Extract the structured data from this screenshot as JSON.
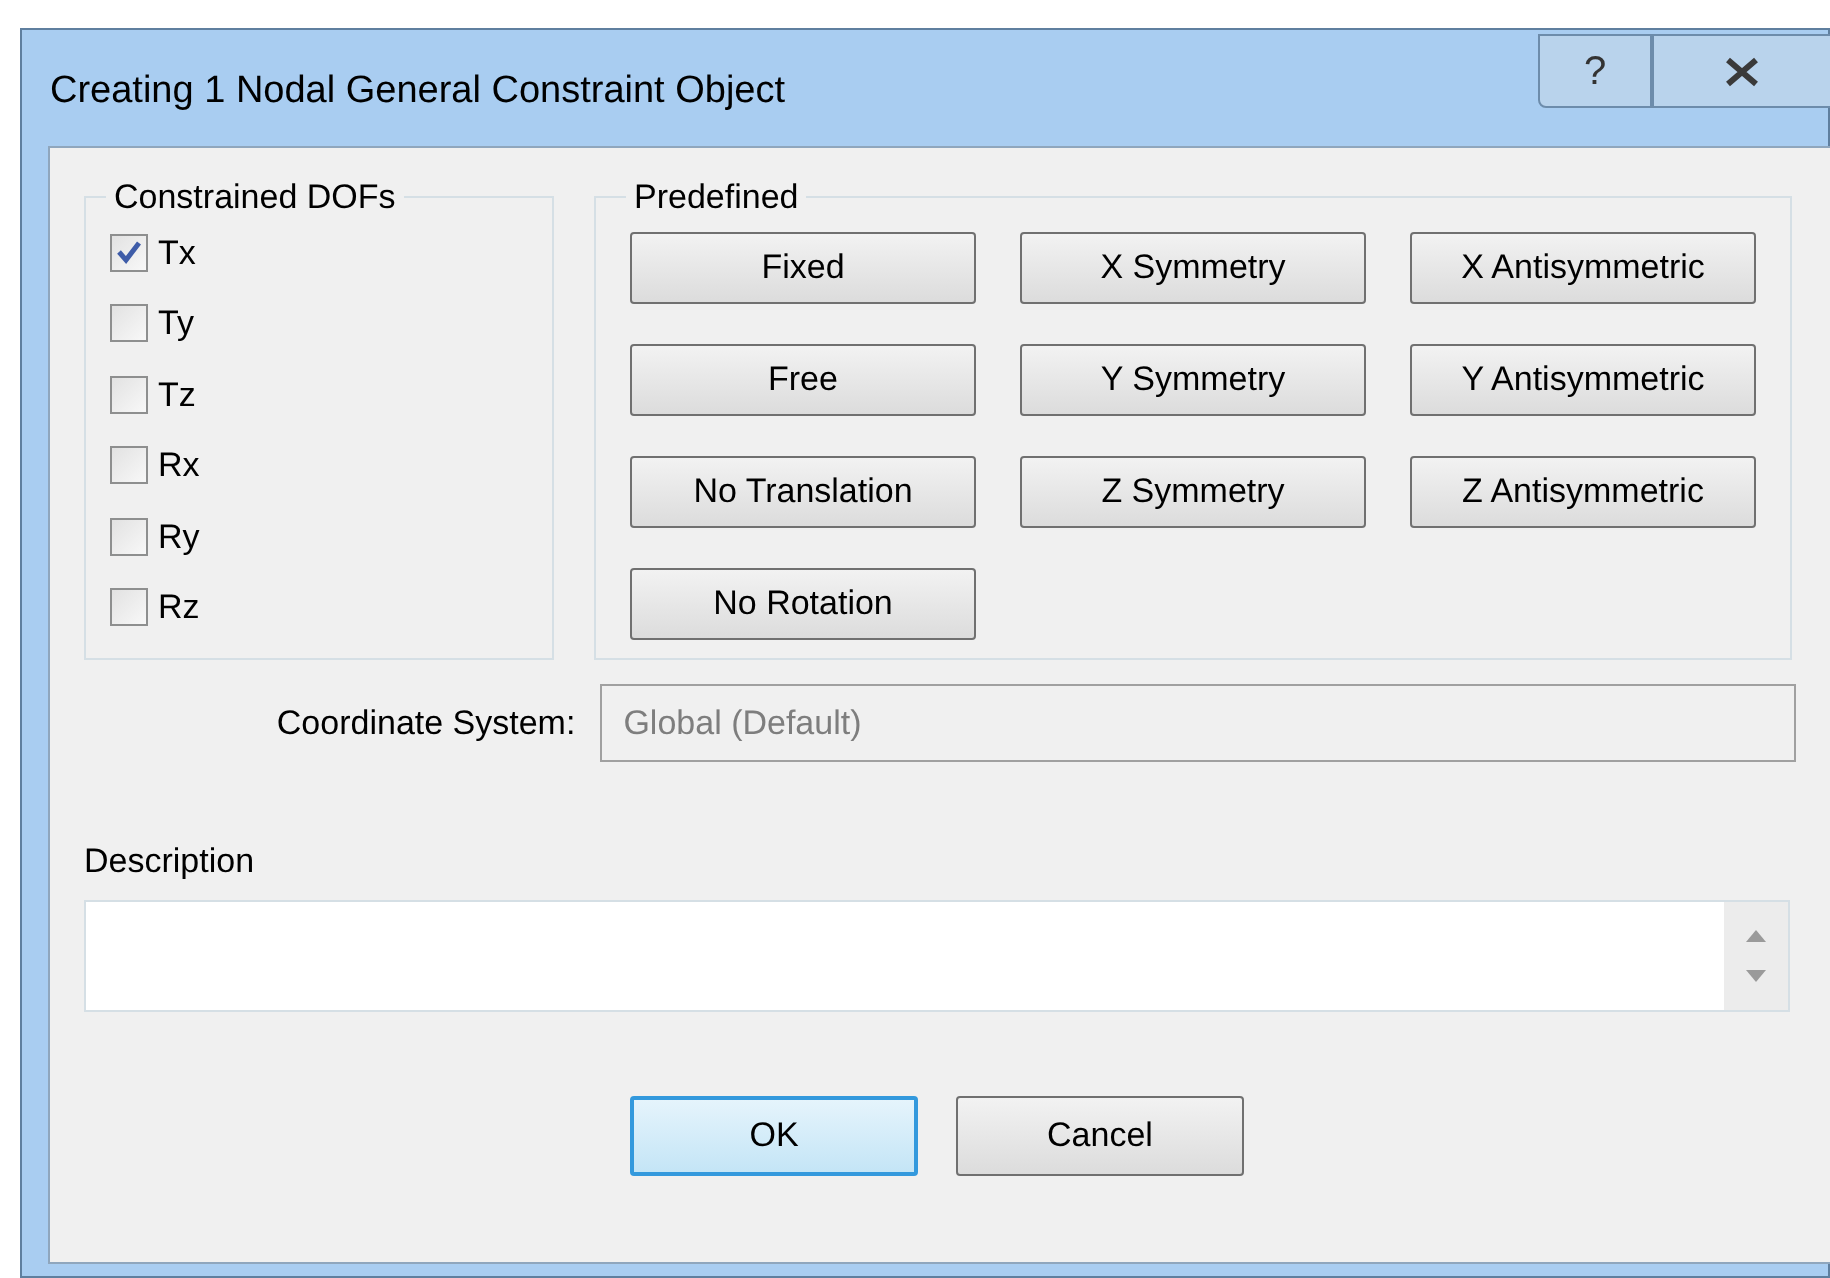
{
  "window": {
    "title": "Creating 1 Nodal General Constraint Object",
    "help_label": "?"
  },
  "constrained_dofs": {
    "title": "Constrained DOFs",
    "items": [
      {
        "label": "Tx",
        "checked": true
      },
      {
        "label": "Ty",
        "checked": false
      },
      {
        "label": "Tz",
        "checked": false
      },
      {
        "label": "Rx",
        "checked": false
      },
      {
        "label": "Ry",
        "checked": false
      },
      {
        "label": "Rz",
        "checked": false
      }
    ]
  },
  "predefined": {
    "title": "Predefined",
    "buttons": [
      {
        "label": "Fixed"
      },
      {
        "label": "X Symmetry"
      },
      {
        "label": "X Antisymmetric"
      },
      {
        "label": "Free"
      },
      {
        "label": "Y Symmetry"
      },
      {
        "label": "Y Antisymmetric"
      },
      {
        "label": "No Translation"
      },
      {
        "label": "Z Symmetry"
      },
      {
        "label": "Z Antisymmetric"
      },
      {
        "label": "No Rotation"
      }
    ]
  },
  "coordinate_system": {
    "label": "Coordinate System:",
    "value": "Global (Default)",
    "disabled": true
  },
  "description": {
    "label": "Description"
  },
  "buttons": [
    {
      "label": "OK",
      "default": true
    },
    {
      "label": "Cancel",
      "default": false
    }
  ]
}
